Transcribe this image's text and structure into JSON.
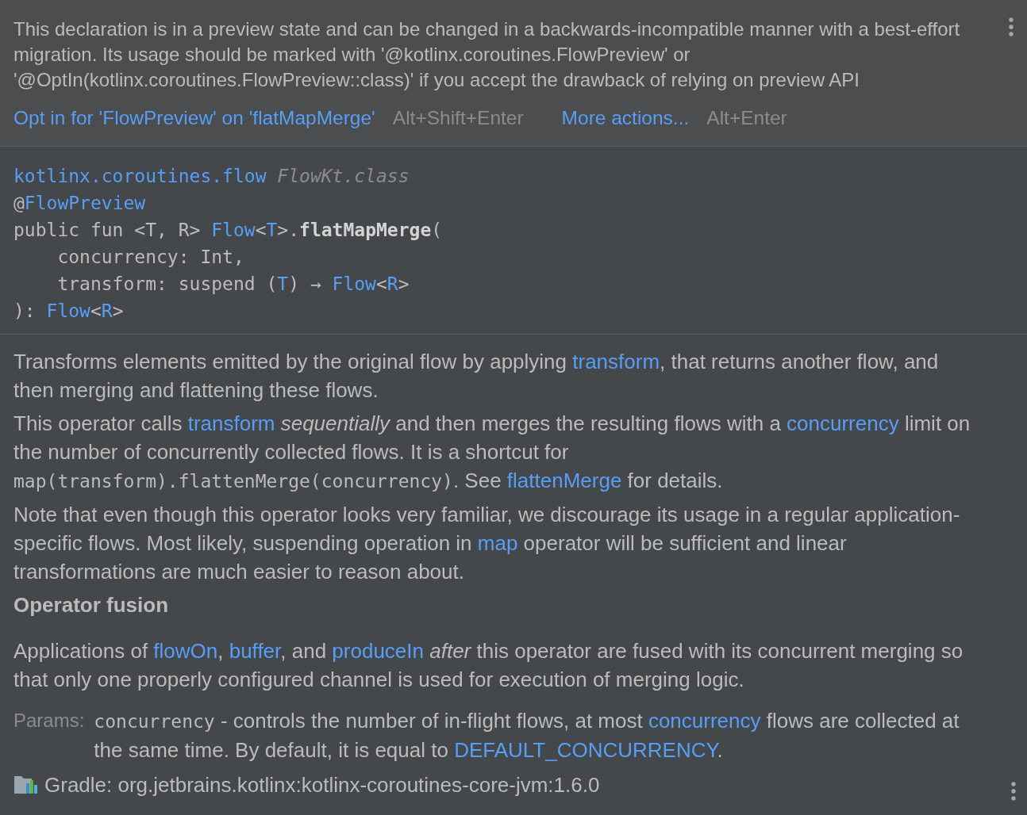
{
  "notice": {
    "text": "This declaration is in a preview state and can be changed in a backwards-incompatible manner with a best-effort migration. Its usage should be marked with '@kotlinx.coroutines.FlowPreview' or '@OptIn(kotlinx.coroutines.FlowPreview::class)' if you accept the drawback of relying on preview API"
  },
  "actions": [
    {
      "label": "Opt in for 'FlowPreview' on 'flatMapMerge'",
      "shortcut": "Alt+Shift+Enter"
    },
    {
      "label": "More actions...",
      "shortcut": "Alt+Enter"
    }
  ],
  "definition": {
    "lines": [
      {
        "tokens": [
          {
            "kind": "ref",
            "text": "kotlinx.coroutines.flow"
          },
          {
            "kind": "muted",
            "text": " FlowKt.class"
          }
        ]
      },
      {
        "tokens": [
          {
            "kind": "plain",
            "text": "@"
          },
          {
            "kind": "ref",
            "text": "FlowPreview"
          }
        ]
      },
      {
        "tokens": [
          {
            "kind": "plain",
            "text": "public fun <T, R> "
          },
          {
            "kind": "ref",
            "text": "Flow"
          },
          {
            "kind": "plain",
            "text": "<"
          },
          {
            "kind": "ref",
            "text": "T"
          },
          {
            "kind": "plain",
            "text": ">."
          },
          {
            "kind": "declaration",
            "text": "flatMapMerge"
          },
          {
            "kind": "plain",
            "text": "("
          }
        ],
        "children": [
          {
            "tokens": [
              {
                "kind": "plain",
                "text": "concurrency: Int,"
              }
            ]
          },
          {
            "tokens": [
              {
                "kind": "plain",
                "text": "transform: suspend ("
              },
              {
                "kind": "ref",
                "text": "T"
              },
              {
                "kind": "plain",
                "text": ") → "
              },
              {
                "kind": "ref",
                "text": "Flow"
              },
              {
                "kind": "plain",
                "text": "<"
              },
              {
                "kind": "ref",
                "text": "R"
              },
              {
                "kind": "plain",
                "text": ">"
              }
            ]
          }
        ]
      },
      {
        "tokens": [
          {
            "kind": "plain",
            "text": "): "
          },
          {
            "kind": "ref",
            "text": "Flow"
          },
          {
            "kind": "plain",
            "text": "<"
          },
          {
            "kind": "ref",
            "text": "R"
          },
          {
            "kind": "plain",
            "text": ">"
          }
        ]
      }
    ]
  },
  "body": [
    {
      "kind": "paragraph",
      "segments": [
        {
          "kind": "text",
          "text": "Transforms elements emitted by the original flow by applying "
        },
        {
          "kind": "link",
          "text": "transform"
        },
        {
          "kind": "text",
          "text": ", that returns another flow, and then merging and flattening these flows."
        }
      ]
    },
    {
      "kind": "paragraph",
      "segments": [
        {
          "kind": "text",
          "text": "This operator calls "
        },
        {
          "kind": "link",
          "text": "transform"
        },
        {
          "kind": "italic",
          "text": " sequentially"
        },
        {
          "kind": "text",
          "text": " and then merges the resulting flows with a "
        },
        {
          "kind": "link",
          "text": "concurrency"
        },
        {
          "kind": "text",
          "text": " limit on the number of concurrently collected flows. It is a shortcut for "
        },
        {
          "kind": "code",
          "text": "map(transform).flattenMerge(concurrency)"
        },
        {
          "kind": "text",
          "text": ". See "
        },
        {
          "kind": "link",
          "text": "flattenMerge"
        },
        {
          "kind": "text",
          "text": " for details."
        }
      ]
    },
    {
      "kind": "paragraph",
      "segments": [
        {
          "kind": "text",
          "text": "Note that even though this operator looks very familiar, we discourage its usage in a regular application-specific flows. Most likely, suspending operation in "
        },
        {
          "kind": "link",
          "text": "map"
        },
        {
          "kind": "text",
          "text": " operator will be sufficient and linear transformations are much easier to reason about."
        }
      ]
    },
    {
      "kind": "heading",
      "text": "Operator fusion"
    },
    {
      "kind": "paragraph",
      "segments": [
        {
          "kind": "text",
          "text": "Applications of "
        },
        {
          "kind": "link",
          "text": "flowOn"
        },
        {
          "kind": "text",
          "text": ", "
        },
        {
          "kind": "link",
          "text": "buffer"
        },
        {
          "kind": "text",
          "text": ", and "
        },
        {
          "kind": "link",
          "text": "produceIn"
        },
        {
          "kind": "italic",
          "text": " after"
        },
        {
          "kind": "text",
          "text": " this operator are fused with its concurrent merging so that only one properly configured channel is used for execution of merging logic."
        }
      ]
    }
  ],
  "params": {
    "label": "Params:",
    "entries": [
      {
        "segments": [
          {
            "kind": "code",
            "text": "concurrency"
          },
          {
            "kind": "text",
            "text": " - controls the number of in-flight flows, at most "
          },
          {
            "kind": "link",
            "text": "concurrency"
          },
          {
            "kind": "text",
            "text": " flows are collected at the same time. By default, it is equal to "
          },
          {
            "kind": "link",
            "text": "DEFAULT_CONCURRENCY"
          },
          {
            "kind": "text",
            "text": "."
          }
        ]
      }
    ]
  },
  "footer": {
    "library": "Gradle: org.jetbrains.kotlinx:kotlinx-coroutines-core-jvm:1.6.0"
  }
}
